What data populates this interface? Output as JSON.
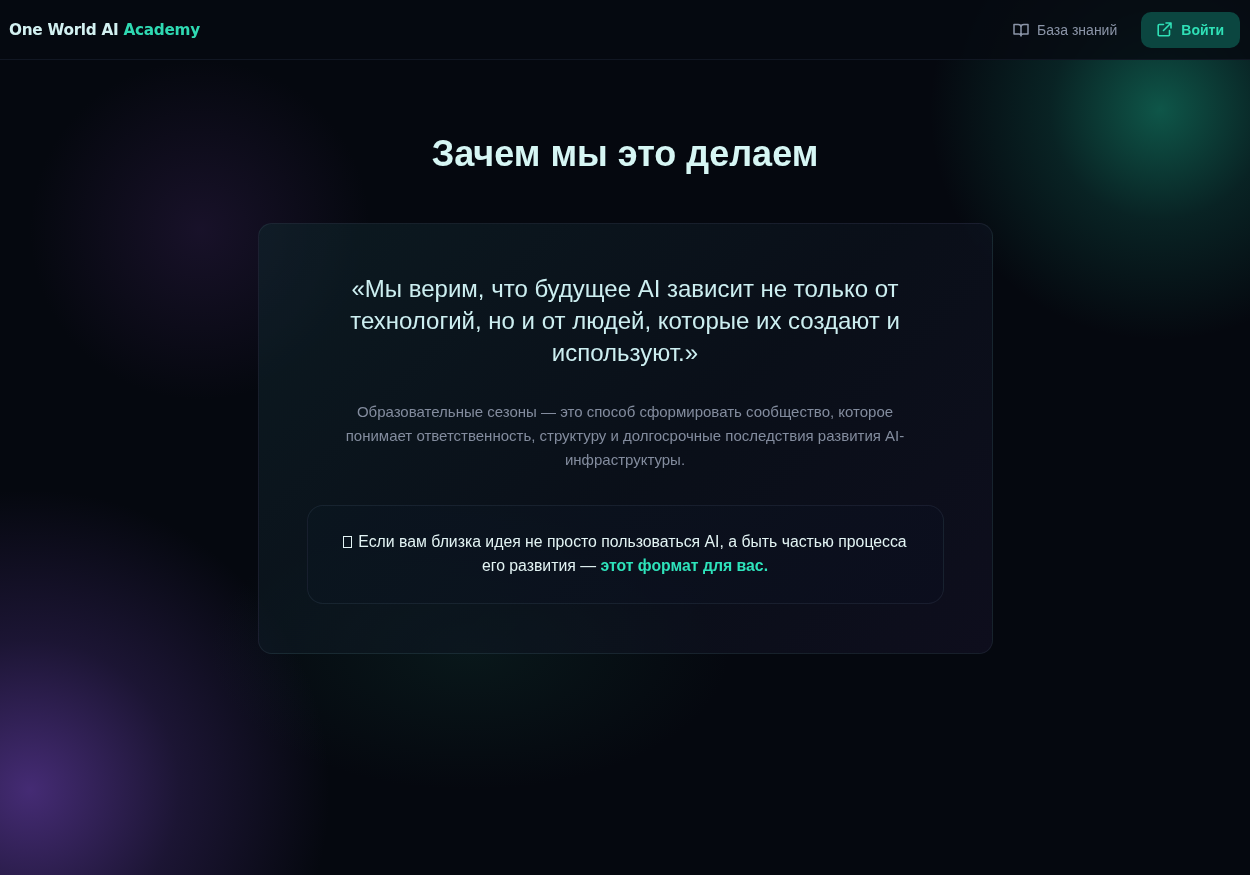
{
  "header": {
    "logo": {
      "text": "One World AI",
      "accent": "Academy"
    },
    "nav": [
      {
        "kind": "link",
        "label": "База знаний"
      },
      {
        "kind": "button",
        "label": "Войти"
      }
    ]
  },
  "section": {
    "title": "Зачем мы это делаем",
    "quote": "«Мы верим, что будущее AI зависит не только от технологий, но и от людей, которые их создают и используют.»",
    "description": "Образовательные сезоны — это способ сформировать сообщество, которое понимает ответственность, структуру и долгосрочные последствия развития AI-инфраструктуры.",
    "callout": "Если вам близка идея не просто пользоваться AI, а быть частью процесса его развития — **этот формат для вас.**"
  }
}
